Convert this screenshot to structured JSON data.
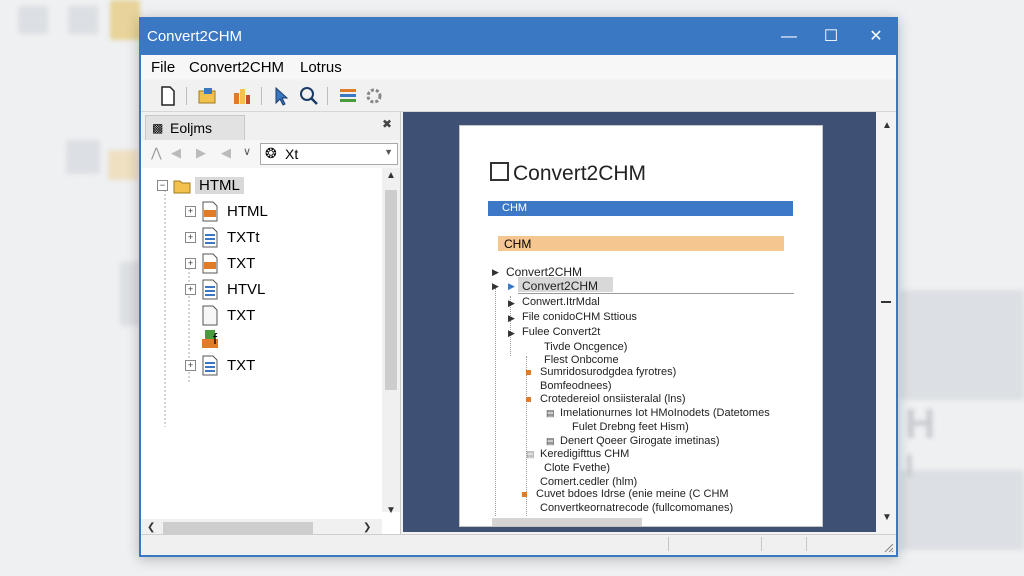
{
  "window": {
    "title": "Convert2CHM"
  },
  "menu": {
    "items": [
      "File",
      "Convert2CHM",
      "Lotrus"
    ]
  },
  "left_pane": {
    "tab_label": "Eoljms",
    "combo_value": "Xt",
    "tree": [
      {
        "label": "HTML",
        "kind": "folder",
        "expander": "−"
      },
      {
        "label": "HTML",
        "kind": "html",
        "expander": "+"
      },
      {
        "label": "TXTt",
        "kind": "txt",
        "expander": "+"
      },
      {
        "label": "TXT",
        "kind": "html",
        "expander": "+"
      },
      {
        "label": "HTVL",
        "kind": "txt",
        "expander": "+"
      },
      {
        "label": "TXT",
        "kind": "blank",
        "expander": ""
      },
      {
        "label": "f",
        "kind": "green",
        "expander": ""
      },
      {
        "label": "TXT",
        "kind": "txt",
        "expander": "+"
      }
    ]
  },
  "document": {
    "title": "Convert2CHM",
    "blue_bar": "CHM",
    "orange_bar": "CHM",
    "lines": [
      "Convert2CHM",
      "Convert2CHM",
      "Conwert.ItrMdal",
      "File conidoCHM Sttious",
      "Fulee Convert2t",
      "Tivde Oncgence)",
      "Flest Onbcome",
      "Sumridosurodgdea fyrotres)",
      "Bomfeodnees)",
      "Crotedereiol onsiisteralal (lns)",
      "Imelationurnes Iot HMoInodets (Datetomes",
      "Fulet Drebng feet Hism)",
      "Denert Qoeer Girogate imetinas)",
      "Keredigifttus CHM",
      "Clote Fvethe)",
      "Comert.cedler (hlm)",
      "Cuvet bdoes Idrse (enie meine (C CHM",
      "Convertkeornatrecode (fullcomomanes)"
    ]
  },
  "colors": {
    "accent": "#3b78c4",
    "orange": "#f5c68f",
    "panel": "#3e5174"
  }
}
